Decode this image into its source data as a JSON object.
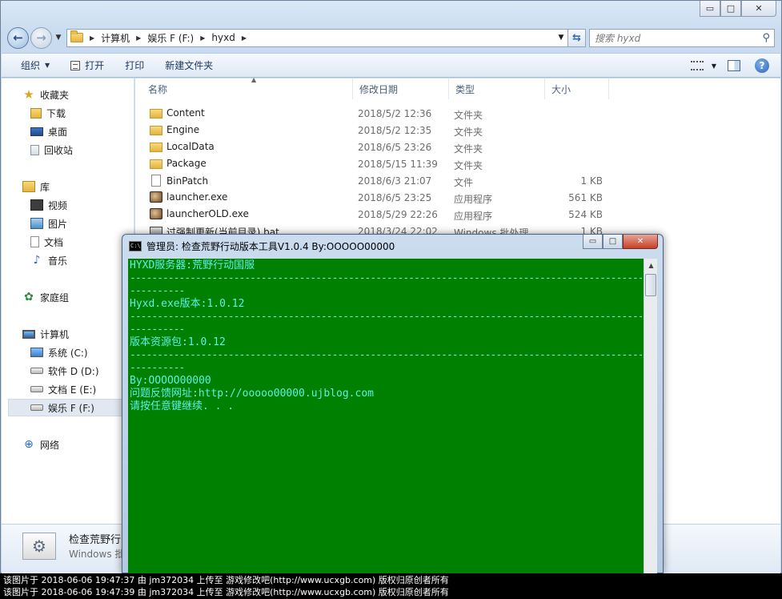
{
  "explorer": {
    "caption_buttons": {
      "minimize": "▭",
      "maximize": "□",
      "close": "✕"
    },
    "breadcrumb": [
      "计算机",
      "娱乐 F (F:)",
      "hyxd"
    ],
    "search_placeholder": "搜索 hyxd",
    "toolbar": {
      "organize": "组织",
      "open": "打开",
      "print": "打印",
      "new_folder": "新建文件夹"
    },
    "nav": {
      "favorites": "收藏夹",
      "downloads": "下载",
      "desktop": "桌面",
      "recycle": "回收站",
      "libraries": "库",
      "videos": "视频",
      "pictures": "图片",
      "documents": "文档",
      "music": "音乐",
      "homegroup": "家庭组",
      "computer": "计算机",
      "drive_c": "系统 (C:)",
      "drive_d": "软件 D (D:)",
      "drive_e": "文档 E (E:)",
      "drive_f": "娱乐 F (F:)",
      "network": "网络"
    },
    "columns": {
      "name": "名称",
      "date": "修改日期",
      "type": "类型",
      "size": "大小"
    },
    "files": [
      {
        "name": "Content",
        "date": "2018/5/2 12:36",
        "type": "文件夹",
        "size": "",
        "icon": "folder-icon"
      },
      {
        "name": "Engine",
        "date": "2018/5/2 12:35",
        "type": "文件夹",
        "size": "",
        "icon": "folder-icon"
      },
      {
        "name": "LocalData",
        "date": "2018/6/5 23:26",
        "type": "文件夹",
        "size": "",
        "icon": "folder-icon"
      },
      {
        "name": "Package",
        "date": "2018/5/15 11:39",
        "type": "文件夹",
        "size": "",
        "icon": "folder-icon"
      },
      {
        "name": "BinPatch",
        "date": "2018/6/3 21:07",
        "type": "文件",
        "size": "1 KB",
        "icon": "file-icon"
      },
      {
        "name": "launcher.exe",
        "date": "2018/6/5 23:25",
        "type": "应用程序",
        "size": "561 KB",
        "icon": "exe-icon"
      },
      {
        "name": "launcherOLD.exe",
        "date": "2018/5/29 22:26",
        "type": "应用程序",
        "size": "524 KB",
        "icon": "exe-icon"
      },
      {
        "name": "过强制更新(当前目录).bat",
        "date": "2018/3/24 22:02",
        "type": "Windows 批处理...",
        "size": "1 KB",
        "icon": "bat-icon"
      }
    ],
    "details": {
      "name": "检查荒野行",
      "type": "Windows 批"
    }
  },
  "cmd": {
    "title": "管理员:  检查荒野行动版本工具V1.0.4 By:OOOOO00000",
    "icon_text": "C:\\",
    "lines": [
      "HYXD服务器:荒野行动国服",
      "----------------------------------------------------------------------------------------------------",
      "----------",
      "Hyxd.exe版本:1.0.12",
      "----------------------------------------------------------------------------------------------------",
      "----------",
      "版本资源包:1.0.12",
      "----------------------------------------------------------------------------------------------------",
      "----------",
      "By:OOOOO00000",
      "问题反馈网址:http://ooooo00000.ujblog.com",
      "请按任意键继续. . ."
    ]
  },
  "watermark": [
    "该图片于 2018-06-06 19:47:37 由 jm372034 上传至 游戏修改吧(http://www.ucxgb.com) 版权归原创者所有",
    "该图片于 2018-06-06 19:47:39 由 jm372034 上传至 游戏修改吧(http://www.ucxgb.com) 版权归原创者所有"
  ],
  "colors": {
    "console_bg": "#008000",
    "console_text": "#5cf0e6"
  }
}
